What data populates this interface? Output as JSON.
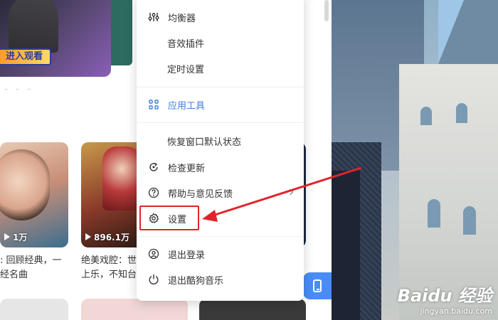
{
  "banner": {
    "cta_label": "进入观看"
  },
  "cards": [
    {
      "play_count": "1万",
      "desc": ": 回顾经典，一\n经名曲"
    },
    {
      "play_count": "896.1万",
      "desc": "绝美戏腔：世\n上乐，不知台"
    }
  ],
  "menu": {
    "items": [
      {
        "label": "均衡器",
        "icon": "equalizer-icon"
      },
      {
        "label": "音效插件"
      },
      {
        "label": "定时设置"
      },
      {
        "label": "应用工具",
        "icon": "grid-apps-icon",
        "active": true
      },
      {
        "label": "恢复窗口默认状态"
      },
      {
        "label": "检查更新",
        "icon": "refresh-icon"
      },
      {
        "label": "帮助与意见反馈",
        "icon": "help-icon",
        "has_submenu": true
      },
      {
        "label": "设置",
        "icon": "gear-icon",
        "highlighted": true
      },
      {
        "label": "退出登录",
        "icon": "user-logout-icon"
      },
      {
        "label": "退出酷狗音乐",
        "icon": "power-icon"
      }
    ]
  },
  "colors": {
    "accent": "#3d7fe0",
    "highlight": "#e0242a",
    "mobile_button": "#4a8cf7"
  },
  "watermark": {
    "brand": "Baidu 经验",
    "url": "jingyan.baidu.com"
  }
}
